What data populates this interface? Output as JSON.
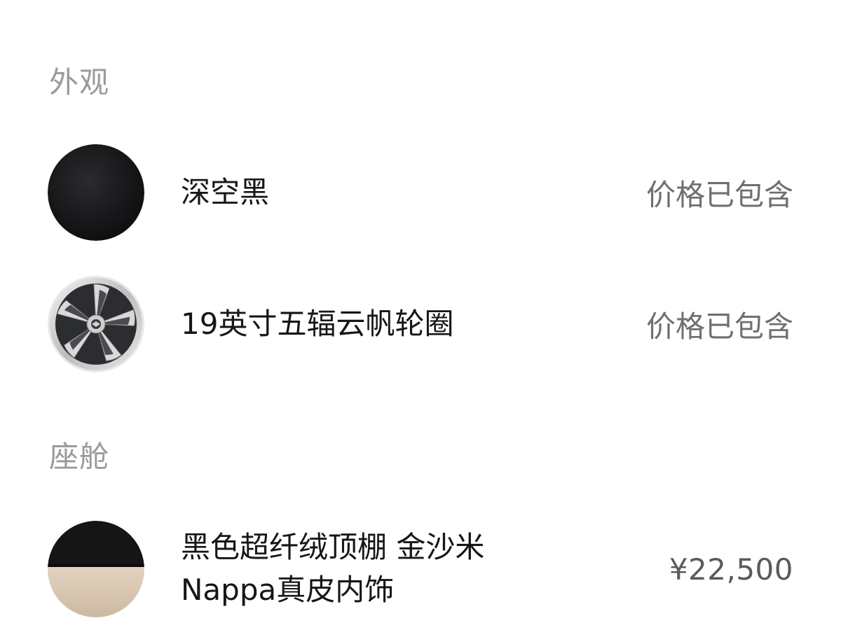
{
  "sections": [
    {
      "title": "外观",
      "items": [
        {
          "name": "深空黑",
          "price": "价格已包含",
          "swatch_icon": "black-paint-swatch-icon"
        },
        {
          "name": "19英寸五辐云帆轮圈",
          "price": "价格已包含",
          "swatch_icon": "wheel-rim-icon"
        }
      ]
    },
    {
      "title": "座舱",
      "items": [
        {
          "name_line1": "黑色超纤绒顶棚 金沙米",
          "name_line2": "Nappa真皮内饰",
          "price": "¥22,500",
          "swatch_icon": "interior-material-swatch-icon"
        }
      ]
    }
  ],
  "colors": {
    "section_title": "#9a9a9a",
    "item_text": "#161616",
    "price_text": "#6f6f6f",
    "paint_black": "#141516",
    "interior_beige": "#d8c6b2"
  }
}
